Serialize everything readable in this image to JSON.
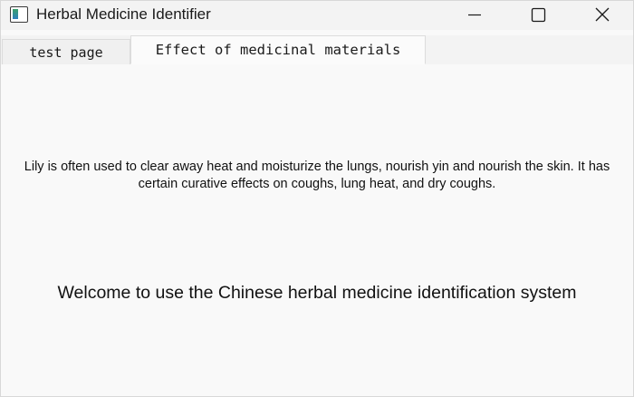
{
  "window": {
    "title": "Herbal Medicine Identifier"
  },
  "tabs": [
    {
      "label": "test page",
      "active": false
    },
    {
      "label": "Effect of medicinal materials",
      "active": true
    }
  ],
  "content": {
    "effect_text": "Lily is often used to clear away heat and moisturize the lungs, nourish yin and nourish the skin. It has certain curative effects on coughs, lung heat, and dry coughs.",
    "welcome_text": "Welcome to use the Chinese herbal medicine identification system"
  },
  "icons": {
    "app": "app-window-icon",
    "minimize": "minimize-icon",
    "maximize": "maximize-icon",
    "close": "close-icon"
  },
  "colors": {
    "window_bg": "#f9f9f9",
    "titlebar_bg": "#f3f3f3",
    "text": "#111111"
  }
}
